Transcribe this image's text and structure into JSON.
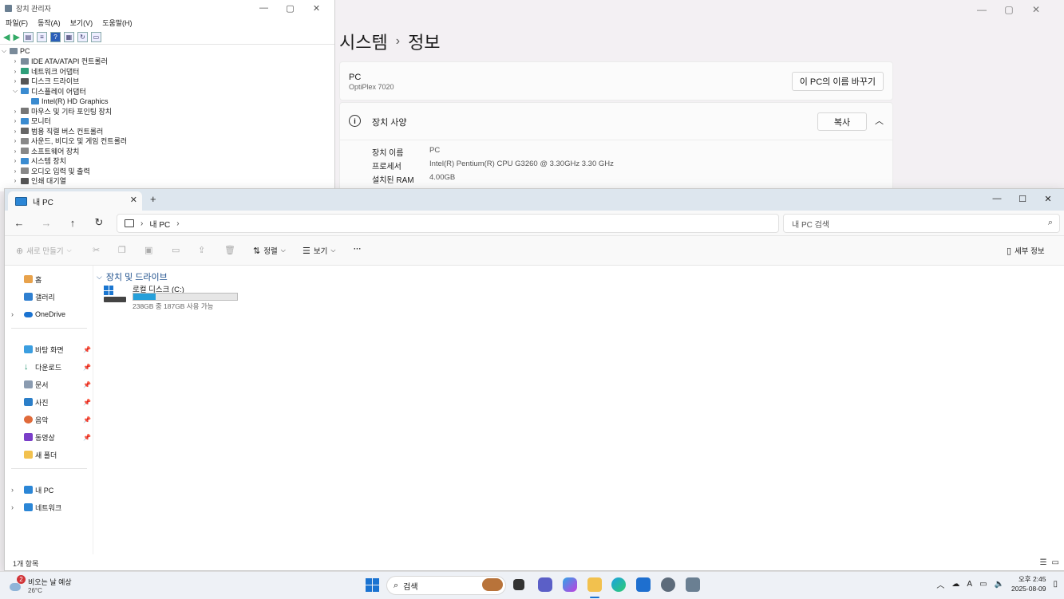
{
  "settings": {
    "breadcrumb_parent": "시스템",
    "breadcrumb_sep": "›",
    "breadcrumb_current": "정보",
    "pc_name": "PC",
    "pc_model": "OptiPlex 7020",
    "rename_button": "이 PC의 이름 바꾸기",
    "spec_title": "장치 사양",
    "copy_button": "복사",
    "specs": [
      {
        "key": "장치 이름",
        "value": "PC"
      },
      {
        "key": "프로세서",
        "value": "Intel(R) Pentium(R) CPU G3260 @ 3.30GHz   3.30 GHz"
      },
      {
        "key": "설치된 RAM",
        "value": "4.00GB"
      }
    ]
  },
  "devmgr": {
    "title": "장치 관리자",
    "menu": [
      "파일(F)",
      "동작(A)",
      "보기(V)",
      "도움말(H)"
    ],
    "root": "PC",
    "items": [
      {
        "label": "IDE ATA/ATAPI 컨트롤러",
        "expanded": false
      },
      {
        "label": "네트워크 어댑터",
        "expanded": false
      },
      {
        "label": "디스크 드라이브",
        "expanded": false
      },
      {
        "label": "디스플레이 어댑터",
        "expanded": true
      },
      {
        "label": "Intel(R) HD Graphics",
        "child": true
      },
      {
        "label": "마우스 및 기타 포인팅 장치",
        "expanded": false
      },
      {
        "label": "모니터",
        "expanded": false
      },
      {
        "label": "범용 직렬 버스 컨트롤러",
        "expanded": false
      },
      {
        "label": "사운드, 비디오 및 게임 컨트롤러",
        "expanded": false
      },
      {
        "label": "소프트웨어 장치",
        "expanded": false
      },
      {
        "label": "시스템 장치",
        "expanded": false
      },
      {
        "label": "오디오 입력 및 출력",
        "expanded": false
      },
      {
        "label": "인쇄 대기열",
        "expanded": false
      }
    ]
  },
  "explorer": {
    "tab_label": "내 PC",
    "address": "내 PC",
    "search_placeholder": "내 PC 검색",
    "cmd": {
      "new": "새로 만들기",
      "sort": "정렬",
      "view": "보기",
      "more": "···",
      "details": "세부 정보"
    },
    "sidebar": {
      "home": "홈",
      "gallery": "갤러리",
      "onedrive": "OneDrive",
      "desktop": "바탕 화면",
      "downloads": "다운로드",
      "documents": "문서",
      "pictures": "사진",
      "music": "음악",
      "videos": "동영상",
      "newfolder": "새 폴더",
      "thispc": "내 PC",
      "network": "네트워크"
    },
    "group_title": "장치 및 드라이브",
    "drive": {
      "name": "로컬 디스크 (C:)",
      "free_text": "238GB 중 187GB 사용 가능",
      "used_fraction": 0.2143
    },
    "status": "1개 항목"
  },
  "taskbar": {
    "weather_text": "비오는 날 예상",
    "temperature": "26°C",
    "notification_count": "2",
    "search_label": "검색",
    "ime": "A",
    "time": "오후 2:45",
    "date": "2025-08-09"
  },
  "colors": {
    "accent": "#1a73d1",
    "drive_bar": "#26a0da",
    "tabbar": "#dde6ee"
  }
}
